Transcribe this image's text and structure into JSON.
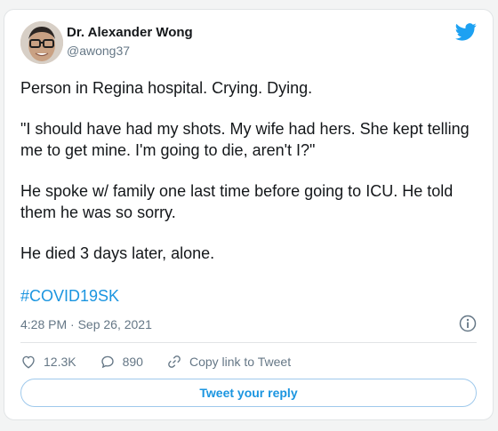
{
  "author": {
    "name": "Dr. Alexander Wong",
    "handle": "@awong37"
  },
  "tweet": {
    "paragraphs": [
      "Person in Regina hospital. Crying. Dying.",
      "\"I should have had my shots. My wife had hers. She kept telling me to get mine. I'm going to die, aren't I?\"",
      "He spoke w/ family one last time before going to ICU. He told them he was so sorry.",
      "He died 3 days later, alone."
    ],
    "hashtag": "#COVID19SK",
    "timestamp": "4:28 PM · Sep 26, 2021"
  },
  "actions": {
    "likes": "12.3K",
    "replies": "890",
    "copy_link_label": "Copy link to Tweet"
  },
  "reply_button_label": "Tweet your reply",
  "icons": [
    "twitter-bird-icon",
    "info-icon",
    "heart-icon",
    "comment-icon",
    "link-icon"
  ],
  "colors": {
    "accent": "#1b95e0",
    "secondary_text": "#657786",
    "border": "#e1e4e6"
  }
}
